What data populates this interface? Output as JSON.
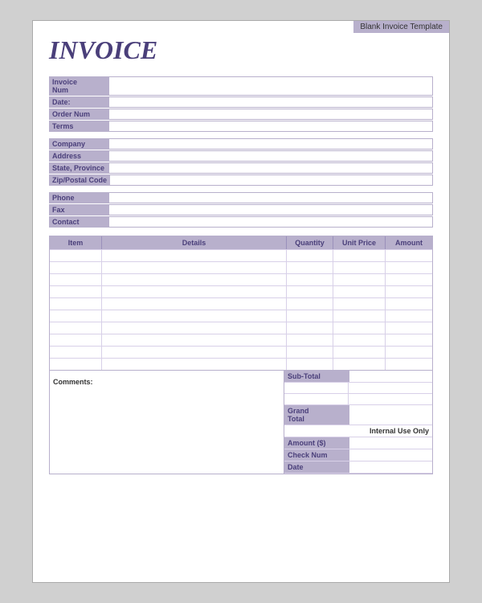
{
  "template": {
    "label": "Blank Invoice Template"
  },
  "invoice": {
    "title": "INVOICE"
  },
  "info_fields": [
    {
      "label": "Invoice\nNum",
      "id": "invoice-num"
    },
    {
      "label": "Date:",
      "id": "date"
    },
    {
      "label": "Order Num",
      "id": "order-num"
    },
    {
      "label": "Terms",
      "id": "terms"
    }
  ],
  "company_fields": [
    {
      "label": "Company",
      "id": "company"
    },
    {
      "label": "Address",
      "id": "address"
    },
    {
      "label": "State, Province",
      "id": "state-province"
    },
    {
      "label": "Zip/Postal Code",
      "id": "zip-postal"
    }
  ],
  "contact_fields": [
    {
      "label": "Phone",
      "id": "phone"
    },
    {
      "label": "Fax",
      "id": "fax"
    },
    {
      "label": "Contact",
      "id": "contact"
    }
  ],
  "table": {
    "headers": [
      {
        "label": "Item",
        "id": "col-item"
      },
      {
        "label": "Details",
        "id": "col-details"
      },
      {
        "label": "Quantity",
        "id": "col-quantity"
      },
      {
        "label": "Unit Price",
        "id": "col-unit-price"
      },
      {
        "label": "Amount",
        "id": "col-amount"
      }
    ],
    "row_count": 10
  },
  "footer": {
    "comments_label": "Comments:",
    "sub_total_label": "Sub-Total",
    "grand_total_label": "Grand\nTotal",
    "internal_use_label": "Internal Use Only",
    "amount_label": "Amount ($)",
    "check_num_label": "Check Num",
    "date_label": "Date"
  }
}
